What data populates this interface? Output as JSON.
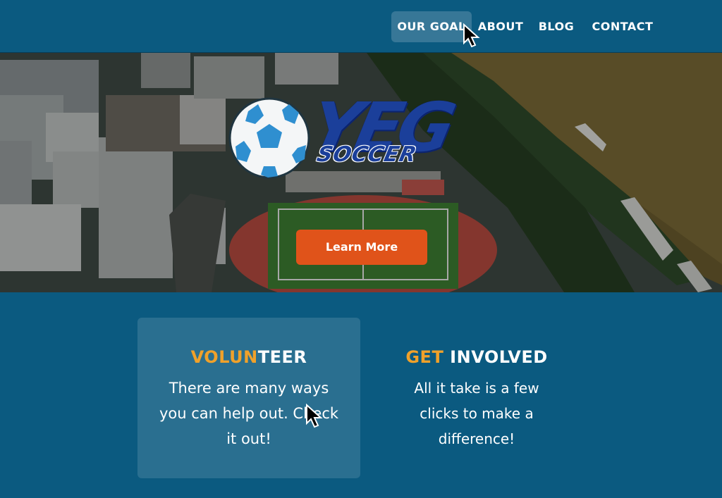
{
  "nav": {
    "items": [
      {
        "label": "OUR GOAL"
      },
      {
        "label": "ABOUT"
      },
      {
        "label": "BLOG"
      },
      {
        "label": "CONTACT"
      }
    ]
  },
  "hero": {
    "logo_letters": "YEG",
    "logo_word": "SOCCER",
    "cta_label": "Learn More"
  },
  "cards": [
    {
      "title_accent": "VOLUN",
      "title_rest": "TEER",
      "body": "There are many ways you can help out. Check it out!"
    },
    {
      "title_accent": "GET",
      "title_rest": " INVOLVED",
      "body": "All it take is a few clicks to make a difference!"
    }
  ],
  "colors": {
    "nav_bg": "#0b5a80",
    "accent_orange": "#f0a12a",
    "cta_orange": "#e0531a",
    "logo_blue": "#1b3f9a"
  }
}
